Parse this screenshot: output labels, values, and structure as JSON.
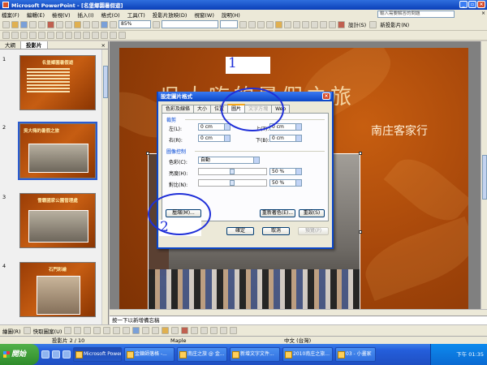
{
  "window": {
    "title": "Microsoft PowerPoint - [名堡鄉園暑假遊]"
  },
  "menu": {
    "items": [
      "檔案(F)",
      "編輯(E)",
      "檢視(V)",
      "插入(I)",
      "格式(O)",
      "工具(T)",
      "投影片放映(D)",
      "視窗(W)",
      "說明(H)"
    ],
    "help_placeholder": "輸入需要解答的問題"
  },
  "toolbar": {
    "zoom": "85%",
    "design_label": "設計(S)",
    "new_slide_label": "新投影片(N)"
  },
  "left_panel": {
    "tabs": [
      "大綱",
      "投影片"
    ],
    "thumbnails": [
      {
        "number": "1",
        "title": "名堡鄉園暑假遊"
      },
      {
        "number": "2",
        "title": "吳大嗨的暑假之旅"
      },
      {
        "number": "3",
        "title": "雪霸國家公園管理處"
      },
      {
        "number": "4",
        "title": "石門彩繪"
      }
    ]
  },
  "slide": {
    "title": "吳大嗨的暑假之旅",
    "subtitle": "南庄客家行"
  },
  "notes": {
    "placeholder": "按一下以新增備忘稿"
  },
  "drawing_toolbar": {
    "draw_label": "繪圖(R)",
    "autoshapes_label": "快取圖案(U)"
  },
  "status": {
    "slide": "投影片 2 / 10",
    "design": "Maple",
    "language": "中文 (台灣)"
  },
  "dialog": {
    "title": "設定圖片格式",
    "tabs": [
      "色彩及線條",
      "大小",
      "位置",
      "圖片",
      "文字方塊",
      "Web"
    ],
    "crop_group": "裁剪",
    "crop": {
      "left_label": "左(L):",
      "left": "0 cm",
      "top_label": "上(T):",
      "top": "0 cm",
      "right_label": "右(R):",
      "right": "0 cm",
      "bottom_label": "下(B):",
      "bottom": "0 cm"
    },
    "image_group": "圖像控制",
    "color_label": "色彩(C):",
    "color_value": "自動",
    "brightness_label": "亮度(H):",
    "brightness": "50 %",
    "contrast_label": "對比(N):",
    "contrast": "50 %",
    "compress_label": "壓縮(M)...",
    "recolor_label": "重新著色(E)...",
    "reset_label": "重設(S)",
    "ok_label": "確定",
    "cancel_label": "取消",
    "preview_label": "預覽(P)"
  },
  "annotations": {
    "one": "1",
    "two": "2"
  },
  "taskbar": {
    "start": "開始",
    "items": [
      "Microsoft Power...",
      "金鍊師落格 -...",
      "南庄之旅 @ 金...",
      "新增文字文件...",
      "2010南庄之旅...",
      "03 - 小畫家"
    ],
    "clock": "下午 01:35"
  }
}
